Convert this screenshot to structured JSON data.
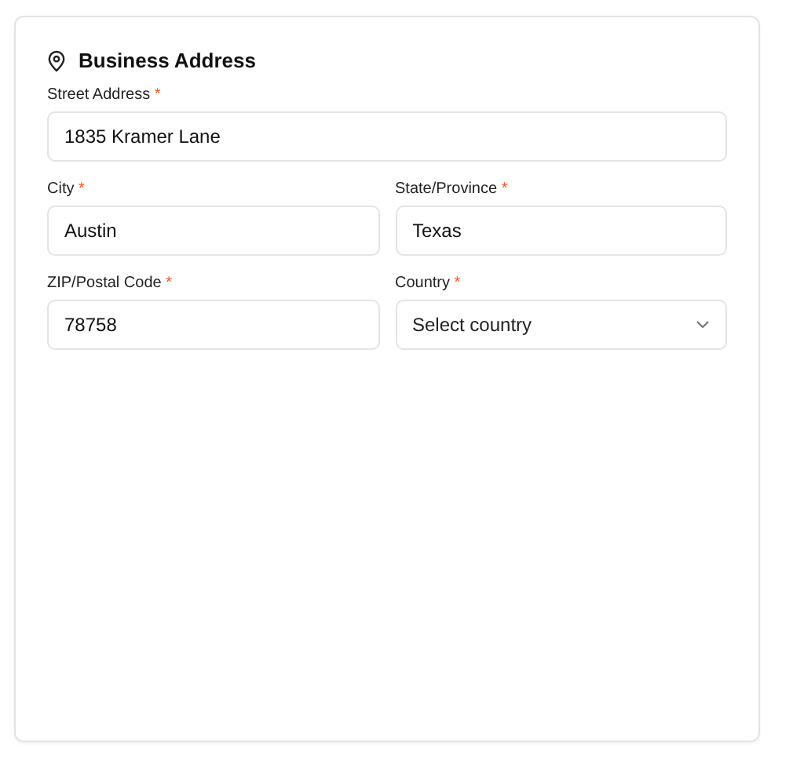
{
  "section": {
    "title": "Business Address"
  },
  "rows": [
    [
      {
        "label": "Street Address",
        "required_mark": "*",
        "kind": "text",
        "value": "1835 Kramer Lane"
      }
    ],
    [
      {
        "label": "City",
        "required_mark": "*",
        "kind": "text",
        "value": "Austin"
      },
      {
        "label": "State/Province",
        "required_mark": "*",
        "kind": "text",
        "value": "Texas"
      }
    ],
    [
      {
        "label": "ZIP/Postal Code",
        "required_mark": "*",
        "kind": "text",
        "value": "78758"
      },
      {
        "label": "Country",
        "required_mark": "*",
        "kind": "select",
        "placeholder": "Select country"
      }
    ]
  ]
}
